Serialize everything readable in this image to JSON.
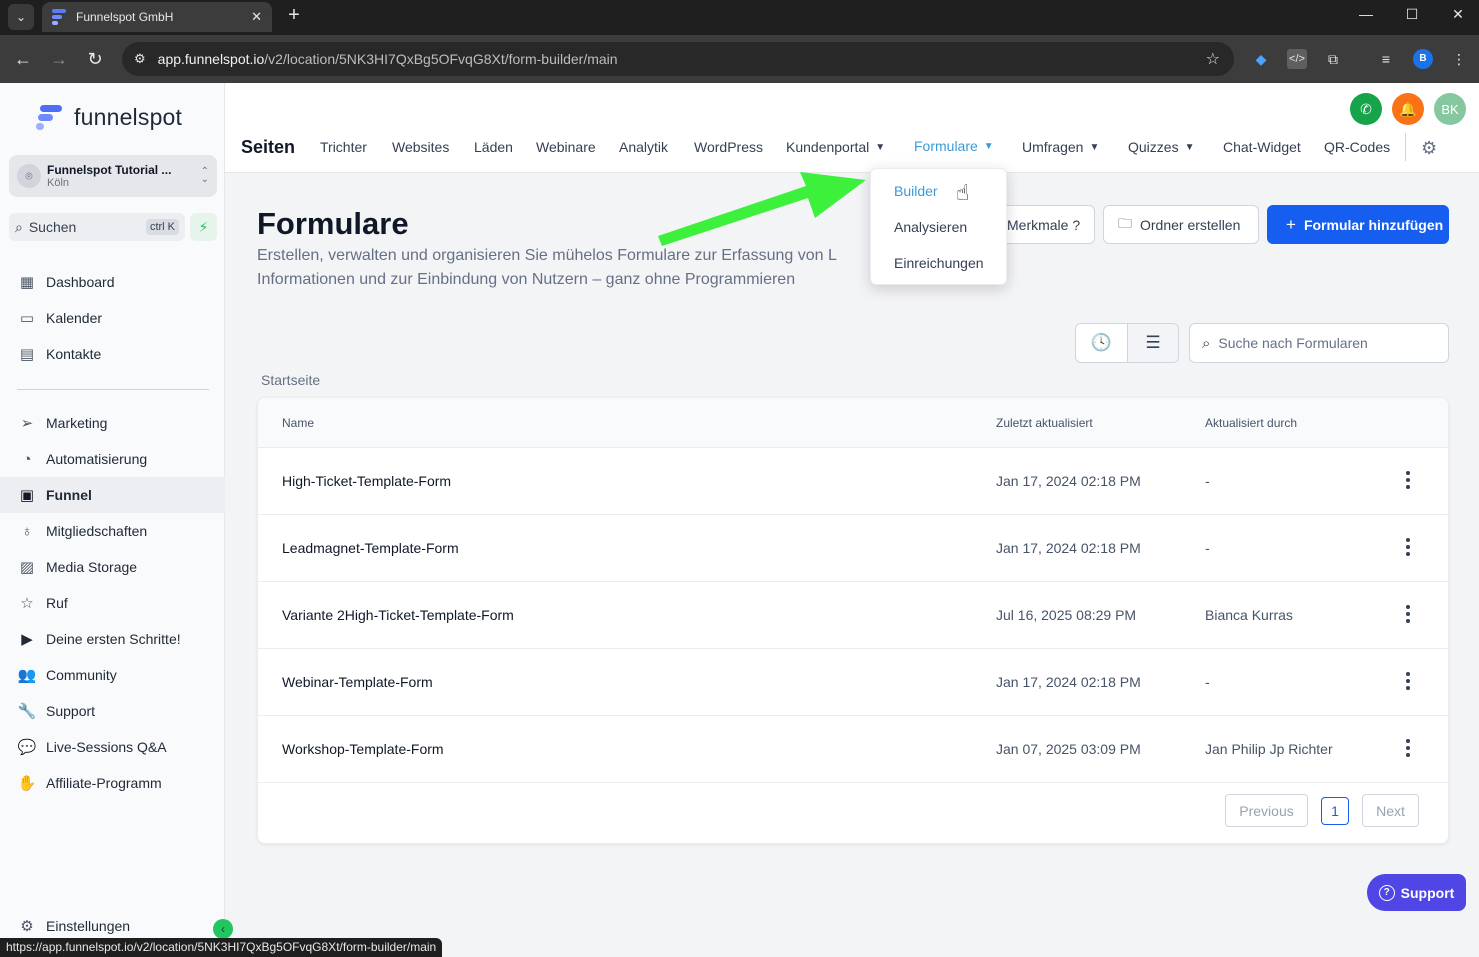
{
  "browser": {
    "tab_title": "Funnelspot GmbH",
    "url_host": "app.funnelspot.io",
    "url_path": "/v2/location/5NK3HI7QxBg5OFvqG8Xt/form-builder/main",
    "status_url": "https://app.funnelspot.io/v2/location/5NK3HI7QxBg5OFvqG8Xt/form-builder/main",
    "profile_initial": "B"
  },
  "sidebar": {
    "logo_text": "funnelspot",
    "account": {
      "name": "Funnelspot Tutorial ...",
      "location": "Köln"
    },
    "search": {
      "label": "Suchen",
      "shortcut": "ctrl K"
    },
    "items": [
      {
        "label": "Dashboard",
        "icon": "dashboard-icon"
      },
      {
        "label": "Kalender",
        "icon": "calendar-icon"
      },
      {
        "label": "Kontakte",
        "icon": "contacts-icon"
      },
      {
        "label": "Marketing",
        "icon": "send-icon"
      },
      {
        "label": "Automatisierung",
        "icon": "automation-icon"
      },
      {
        "label": "Funnel",
        "icon": "funnel-icon",
        "active": true
      },
      {
        "label": "Mitgliedschaften",
        "icon": "award-icon"
      },
      {
        "label": "Media Storage",
        "icon": "image-icon"
      },
      {
        "label": "Ruf",
        "icon": "star-icon"
      },
      {
        "label": "Deine ersten Schritte!",
        "icon": "play-icon"
      },
      {
        "label": "Community",
        "icon": "users-icon"
      },
      {
        "label": "Support",
        "icon": "wrench-icon"
      },
      {
        "label": "Live-Sessions Q&A",
        "icon": "chat-icon"
      },
      {
        "label": "Affiliate-Programm",
        "icon": "hand-coin-icon"
      }
    ],
    "settings_label": "Einstellungen"
  },
  "header": {
    "page_label": "Seiten",
    "avatar_initials": "BK",
    "menu": [
      "Trichter",
      "Websites",
      "Läden",
      "Webinare",
      "Analytik",
      "WordPress",
      "Kundenportal",
      "Formulare",
      "Umfragen",
      "Quizzes",
      "Chat-Widget",
      "QR-Codes"
    ],
    "active_menu": "Formulare"
  },
  "dropdown": {
    "items": [
      "Builder",
      "Analysieren",
      "Einreichungen"
    ],
    "active": "Builder"
  },
  "main": {
    "title": "Formulare",
    "description_line1": "Erstellen, verwalten und organisieren Sie mühelos Formulare zur Erfassung von L",
    "description_line2": "Informationen und zur Einbindung von Nutzern – ganz ohne Programmieren",
    "features_button": "Merkmale ?",
    "create_folder_button": "Ordner erstellen",
    "add_form_button": "Formular hinzufügen",
    "search_placeholder": "Suche nach Formularen",
    "breadcrumb": "Startseite"
  },
  "table": {
    "columns": [
      "Name",
      "Zuletzt aktualisiert",
      "Aktualisiert durch"
    ],
    "rows": [
      {
        "name": "High-Ticket-Template-Form",
        "updated": "Jan 17, 2024 02:18 PM",
        "by": "-"
      },
      {
        "name": "Leadmagnet-Template-Form",
        "updated": "Jan 17, 2024 02:18 PM",
        "by": "-"
      },
      {
        "name": "Variante 2High-Ticket-Template-Form",
        "updated": "Jul 16, 2025 08:29 PM",
        "by": "Bianca Kurras"
      },
      {
        "name": "Webinar-Template-Form",
        "updated": "Jan 17, 2024 02:18 PM",
        "by": "-"
      },
      {
        "name": "Workshop-Template-Form",
        "updated": "Jan 07, 2025 03:09 PM",
        "by": "Jan Philip Jp Richter"
      }
    ],
    "pagination": {
      "previous": "Previous",
      "current": "1",
      "next": "Next"
    }
  },
  "support_fab": "Support",
  "colors": {
    "primary": "#155eef",
    "active_menu": "#3b9bd6",
    "arrow": "#3cf03c",
    "phone": "#16a34a",
    "bell": "#f97316",
    "avatar": "#86c7a0"
  }
}
